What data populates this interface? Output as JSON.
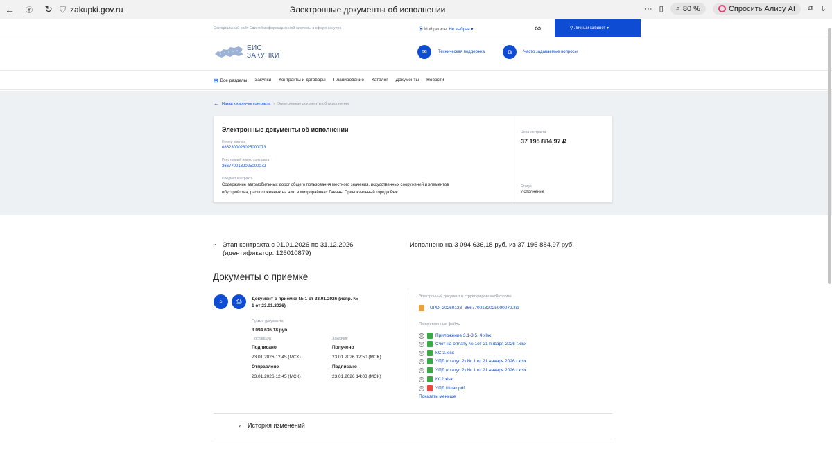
{
  "browser": {
    "url": "zakupki.gov.ru",
    "page_title": "Электронные документы об исполнении",
    "zoom": "80 %",
    "alice": "Спросить Алису AI"
  },
  "topbar": {
    "official": "Официальный сайт Единой информационной системы в сфере закупок",
    "region_label": "Мой регион:",
    "region_value": "Не выбран",
    "cabinet": "Личный кабинет"
  },
  "header": {
    "logo_line1": "ЕИС",
    "logo_line2": "ЗАКУПКИ",
    "support": "Техническая поддержка",
    "faq": "Часто задаваемые вопросы"
  },
  "nav": [
    "Закупки",
    "Контракты и договоры",
    "Планирование",
    "Каталог",
    "Документы",
    "Новости"
  ],
  "nav_all": "Все разделы",
  "breadcrumb": {
    "back": "Назад к карточке контракта",
    "sep": "›",
    "current": "Электронные документы об исполнении"
  },
  "card": {
    "title": "Электронные документы об исполнении",
    "purchase_label": "Номер закупки",
    "purchase_value": "0862300028025000073",
    "registry_label": "Реестровый номер контракта",
    "registry_value": "3667700132025000072",
    "subject_label": "Предмет контракта",
    "subject_line1": "Содержание автомобильных дорог общего пользования местного значения, искусственных сооружений и элементов",
    "subject_line2": "обустройства, расположенных на них, в микрорайонах Гавань, Привокзальный города Реж",
    "price_label": "Цена контракта",
    "price_value": "37 195 884,97 ₽",
    "status_label": "Статус",
    "status_value": "Исполнение"
  },
  "stage": {
    "line1": "Этап контракта с 01.01.2026 по 31.12.2026",
    "line2": "(идентификатор: 126010879)",
    "executed": "Исполнено на 3 094 636,18 руб. из 37 195 884,97 руб."
  },
  "section_title": "Документы о приемке",
  "doc": {
    "title_line1": "Документ о приемке № 1 от 23.01.2026 (испр. №",
    "title_line2": "1 от 23.01.2026)",
    "sum_label": "Сумма документа",
    "sum_value": "3 094 636,18 руб.",
    "supplier_label": "Поставщик",
    "customer_label": "Заказчик",
    "signed": "Подписано",
    "signed_time": "23.01.2026 12:45 (МСК)",
    "received": "Получено",
    "received_time": "23.01.2026 12:50 (МСК)",
    "sent": "Отправлено",
    "sent_time": "23.01.2026 12:45 (МСК)",
    "signed2": "Подписано",
    "signed2_time": "23.01.2026 14:03 (МСК)"
  },
  "files": {
    "structured_label": "Электронный документ в структурированной форме",
    "structured_file": "UPD_20260123_3667700132025000072.zip",
    "attached_label": "Прикрепленные файлы",
    "attached": [
      {
        "name": "Приложение 3.1-3.5, 4.xlsx",
        "type": "green"
      },
      {
        "name": "Счет на оплату № 1от 21 января 2026 г.xlsx",
        "type": "green"
      },
      {
        "name": "КС 3.xlsx",
        "type": "green"
      },
      {
        "name": "УПД (статус 2) № 1 от 21 января 2026 г.xlsx",
        "type": "green"
      },
      {
        "name": "УПД (статус 2) № 1 от 21 января 2026 г.xlsx",
        "type": "green"
      },
      {
        "name": "КС2.xlsx",
        "type": "green"
      },
      {
        "name": "УПД Шлак.pdf",
        "type": "red"
      }
    ],
    "show_less": "Показать меньше"
  },
  "history": "История изменений",
  "colors": {
    "accent": "#0d4cd3",
    "muted": "#8c96a3",
    "band": "#eef1f4"
  }
}
